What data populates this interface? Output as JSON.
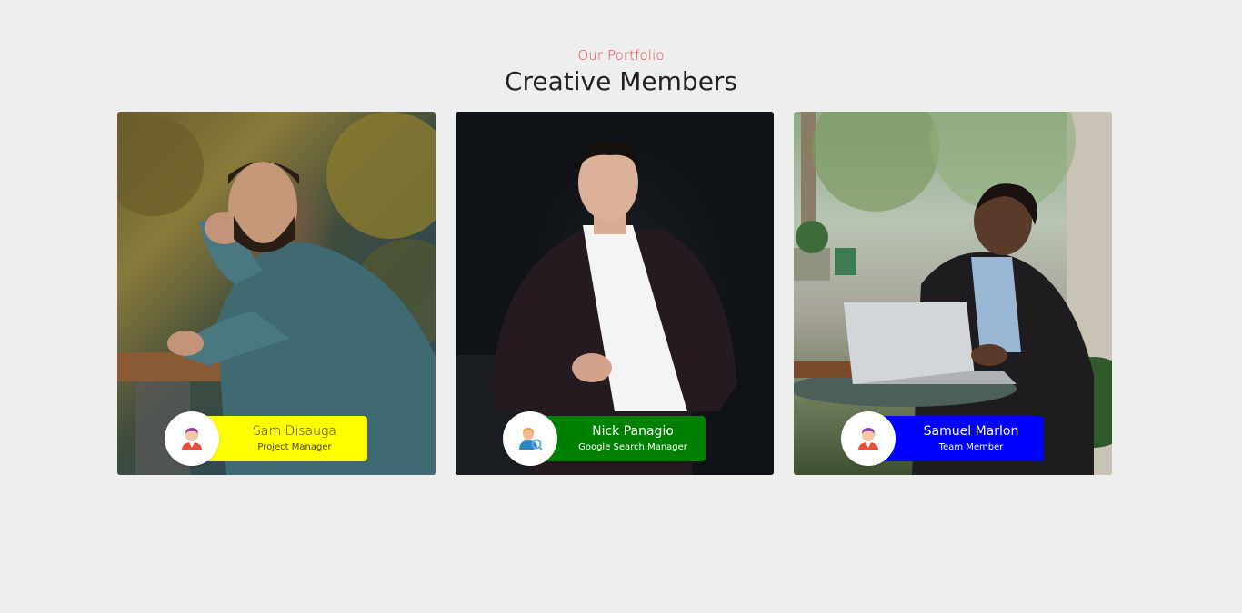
{
  "section": {
    "subtitle": "Our Portfolio",
    "title": "Creative Members"
  },
  "members": [
    {
      "name": "Sam Disauga",
      "role": "Project Manager",
      "badge_color": "#ffff00",
      "avatar_icon": "manager-avatar-icon",
      "photo": "man-in-teal-suit-photo"
    },
    {
      "name": "Nick Panagio",
      "role": "Google Search Manager",
      "badge_color": "#008000",
      "avatar_icon": "search-user-avatar-icon",
      "photo": "man-in-dark-blazer-photo"
    },
    {
      "name": "Samuel Marlon",
      "role": "Team Member",
      "badge_color": "#0000ff",
      "avatar_icon": "manager-avatar-icon",
      "photo": "man-with-laptop-photo"
    }
  ],
  "colors": {
    "accent": "#e0474c",
    "background": "#eeeeee",
    "heading": "#222222"
  }
}
